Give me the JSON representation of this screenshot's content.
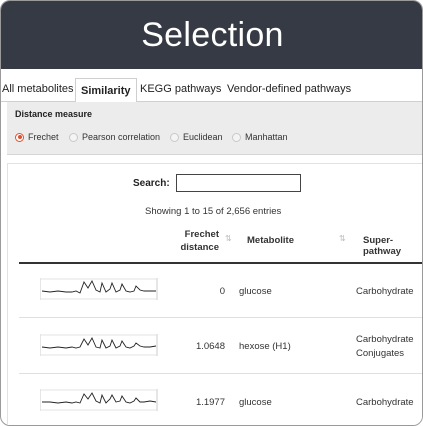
{
  "banner": {
    "title": "Selection"
  },
  "tabs": [
    {
      "label": "All metabolites",
      "active": false
    },
    {
      "label": "Similarity",
      "active": true
    },
    {
      "label": "KEGG pathways",
      "active": false
    },
    {
      "label": "Vendor-defined pathways",
      "active": false
    }
  ],
  "distance_measure": {
    "title": "Distance measure",
    "options": [
      {
        "label": "Frechet",
        "selected": true
      },
      {
        "label": "Pearson correlation",
        "selected": false
      },
      {
        "label": "Euclidean",
        "selected": false
      },
      {
        "label": "Manhattan",
        "selected": false
      }
    ],
    "accent_color": "#e0502f"
  },
  "table": {
    "search_label": "Search:",
    "search_value": "",
    "info": "Showing 1 to 15 of 2,656 entries",
    "columns": [
      {
        "label_line1": "Frechet",
        "label_line2": "distance"
      },
      {
        "label": "Metabolite"
      },
      {
        "label": "Super-pathway"
      }
    ],
    "rows": [
      {
        "distance": "0",
        "metabolite": "glucose",
        "super_pathway": "Carbohydrate",
        "super_pathway_line2": ""
      },
      {
        "distance": "1.0648",
        "metabolite": "hexose (H1)",
        "super_pathway": "Carbohydrate",
        "super_pathway_line2": "Conjugates"
      },
      {
        "distance": "1.1977",
        "metabolite": "glucose",
        "super_pathway": "Carbohydrate",
        "super_pathway_line2": ""
      }
    ]
  },
  "colors": {
    "banner_bg": "#363a44",
    "panel_bg": "#ececec",
    "sparkline": "#222222"
  }
}
